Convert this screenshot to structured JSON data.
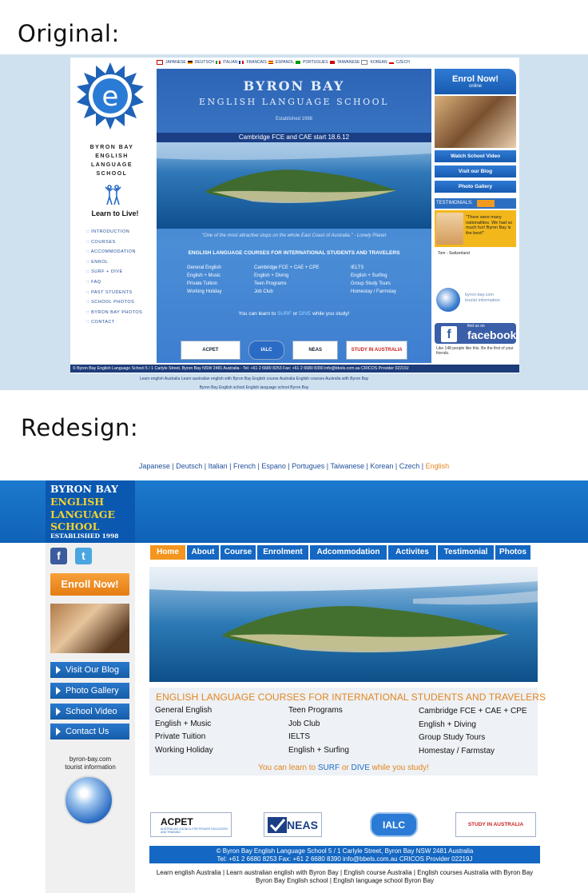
{
  "labels": {
    "original": "Original:",
    "redesign": "Redesign:"
  },
  "original": {
    "languages": [
      "JAPANESE",
      "DEUTSCH",
      "ITALIAN",
      "FRANCAIS",
      "ESPANOL",
      "PORTUGUES",
      "TAIWANESE",
      "KOREAN",
      "CZECH"
    ],
    "logo_letter": "e",
    "school_name": [
      "BYRON BAY",
      "ENGLISH",
      "LANGUAGE",
      "SCHOOL"
    ],
    "slogan": "Learn to Live!",
    "nav": [
      ":: INTRODUCTION",
      ":: COURSES",
      ":: ACCOMMODATION",
      ":: ENROL",
      ":: SURF + DIVE",
      ":: FAQ",
      ":: PAST STUDENTS",
      ":: SCHOOL PHOTOS",
      ":: BYRON BAY PHOTOS",
      ":: CONTACT"
    ],
    "title1": "BYRON BAY",
    "title2": "ENGLISH LANGUAGE SCHOOL",
    "established": "Established 1998",
    "banner": "Cambridge FCE and CAE start 18.6.12",
    "quote": "\"One of the most attractive stops on the whole East Coast of Australia.\" - Lonely Planet",
    "courses_heading": "ENGLISH LANGUAGE COURSES FOR INTERNATIONAL STUDENTS AND TRAVELERS",
    "courses_col1": [
      "General English",
      "English + Music",
      "Private Tuition",
      "Working Holiday"
    ],
    "courses_col2": [
      "Cambridge FCE + CAE + CPE",
      "English + Diving",
      "Teen Programs",
      "Job Club"
    ],
    "courses_col3": [
      "IELTS",
      "English + Surfing",
      "Group Study Tours",
      "Homestay / Farmstay"
    ],
    "surf_pre": "You can learn to ",
    "surf_word": "SURF",
    "surf_mid": " or ",
    "dive_word": "DIVE",
    "surf_post": " while you study!",
    "logos": [
      "ACPET",
      "IALC",
      "NEAS",
      "STUDY IN AUSTRALIA"
    ],
    "enrol": "Enrol Now!",
    "enrol_sub": "online",
    "right_buttons": [
      "Watch School Video",
      "Visit our Blog",
      "Photo Gallery"
    ],
    "testimonials_label": "TESTIMONIALS:",
    "testimonial_text": "\"There were many nationalities. We had so much fun! Byron Bay is the best!\"",
    "testimonial_who": "Tom - Switzerland",
    "tourist": "byron-bay.com\ntourist information",
    "fb_small": "find us on",
    "fb_big": "facebook",
    "fb_like": "Like   148 people like this. Be the first of your friends.",
    "footer": "© Byron Bay English Language School 5 / 1 Carlyle Street, Byron Bay NSW 2481 Australia  - Tel: +61 2 6680 8253 Fax: +61 2 6680 8390 info@bbels.com.au  CRICOS Provider 02219J",
    "bottom_links": "Learn english Australia    Learn australian english with Byron Bay    English course Australia    English courses Australia with Byron Bay\nByron Bay English school    English language school Byron Bay"
  },
  "redesign": {
    "languages": [
      "Japanese",
      "Deutsch",
      "Italian",
      "French",
      "Espano",
      "Portugues",
      "Taiwanese",
      "Korean",
      "Czech",
      "English"
    ],
    "logo_line1": "BYRON BAY",
    "logo_line2": "ENGLISH",
    "logo_line3": "LANGUAGE",
    "logo_line4": "SCHOOL",
    "logo_line5": "ESTABLISHED 1998",
    "facebook_glyph": "f",
    "twitter_glyph": "t",
    "enroll": "Enroll Now!",
    "side_buttons": [
      "Visit Our Blog",
      "Photo Gallery",
      "School Video",
      "Contact Us"
    ],
    "tourist": "byron-bay.com\ntourist information",
    "nav": [
      "Home",
      "About",
      "Course",
      "Enrolment",
      "Adcommodation",
      "Activites",
      "Testimonial",
      "Photos"
    ],
    "courses_heading": "ENGLISH LANGUAGE COURSES FOR INTERNATIONAL STUDENTS AND TRAVELERS",
    "courses_col1": [
      "General English",
      "English + Music",
      "Private Tuition",
      "Working Holiday"
    ],
    "courses_col2": [
      "Teen Programs",
      "Job Club",
      "IELTS",
      "English + Surfing"
    ],
    "courses_col3": [
      "Cambridge FCE + CAE + CPE",
      "English + Diving",
      "Group Study Tours",
      "Homestay / Farmstay"
    ],
    "surf_pre": "You can learn to ",
    "surf_word": "SURF",
    "surf_mid": " or ",
    "dive_word": "DIVE",
    "surf_post": " while you study!",
    "logos": [
      "ACPET",
      "NEAS",
      "IALC",
      "STUDY IN AUSTRALIA"
    ],
    "acpet_sub": "AUSTRALIAN COUNCIL FOR PRIVATE EDUCATION AND TRAINING",
    "footer_line1": "© Byron Bay English Language School 5 / 1 Carlyle Street, Byron Bay NSW 2481 Australia",
    "footer_line2": "Tel: +61 2 6680 8253 Fax: +61 2 6680 8390 info@bbels.com.au  CRICOS Provider 02219J",
    "bottom_line1": "Learn english Australia  |  Learn australian english with Byron Bay  |  English course Australia |  English courses Australia with Byron Bay",
    "bottom_line2": "Byron Bay English school  |  English language school Byron Bay"
  },
  "colors": {
    "brand_blue": "#1467c2",
    "accent_orange": "#f3951f",
    "logo_yellow": "#f5d22c"
  }
}
